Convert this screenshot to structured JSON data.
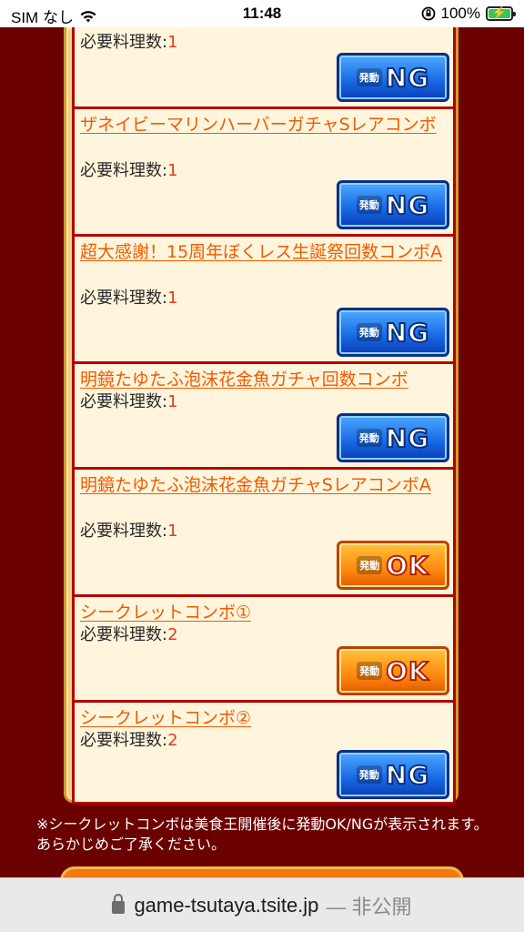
{
  "status_bar": {
    "carrier": "SIM なし",
    "time": "11:48",
    "battery": "100%"
  },
  "combos": [
    {
      "title": "",
      "required_label": "必要料理数:",
      "required_value": "1",
      "status": "NG",
      "button_small": "発動",
      "button_big": "NG"
    },
    {
      "title": "ザネイビーマリンハーバーガチャSレアコンボ",
      "required_label": "必要料理数:",
      "required_value": "1",
      "status": "NG",
      "button_small": "発動",
      "button_big": "NG"
    },
    {
      "title": "超大感謝！15周年ぼくレス生誕祭回数コンボA",
      "required_label": "必要料理数:",
      "required_value": "1",
      "status": "NG",
      "button_small": "発動",
      "button_big": "NG"
    },
    {
      "title": "明鏡たゆたふ泡沫花金魚ガチャ回数コンボ",
      "required_label": "必要料理数:",
      "required_value": "1",
      "status": "NG",
      "button_small": "発動",
      "button_big": "NG"
    },
    {
      "title": "明鏡たゆたふ泡沫花金魚ガチャSレアコンボA",
      "required_label": "必要料理数:",
      "required_value": "1",
      "status": "OK",
      "button_small": "発動",
      "button_big": "OK"
    },
    {
      "title": "シークレットコンボ①",
      "required_label": "必要料理数:",
      "required_value": "2",
      "status": "OK",
      "button_small": "発動",
      "button_big": "OK"
    },
    {
      "title": "シークレットコンボ②",
      "required_label": "必要料理数:",
      "required_value": "2",
      "status": "NG",
      "button_small": "発動",
      "button_big": "NG"
    }
  ],
  "note": "※シークレットコンボは美食王開催後に発動OK/NGが表示されます。あらかじめご了承ください。",
  "url_bar": {
    "domain": "game-tsutaya.tsite.jp",
    "suffix": "— 非公開"
  },
  "colors": {
    "background": "#6b0000",
    "title": "#f05a00",
    "ng_button": "#1767e3",
    "ok_button": "#ff8a10"
  },
  "icons": [
    "wifi-icon",
    "orientation-lock-icon",
    "battery-charging-icon",
    "lock-icon"
  ]
}
